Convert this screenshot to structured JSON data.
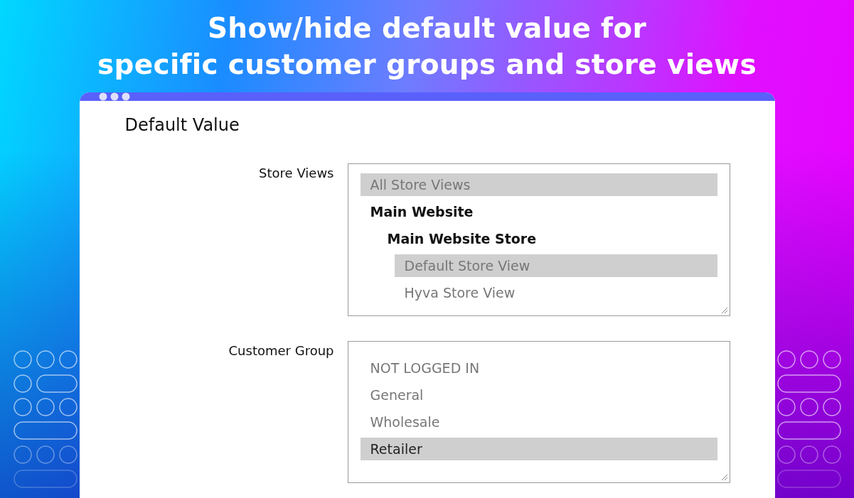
{
  "headline": [
    "Show/hide default value for",
    "specific customer groups and store views"
  ],
  "section_title": "Default Value",
  "fields": [
    {
      "label": "Store Views",
      "options": [
        {
          "text": "All Store Views",
          "kind": "option",
          "selected": true
        },
        {
          "text": "Main Website",
          "kind": "group",
          "children": [
            {
              "text": "Main Website Store",
              "kind": "group",
              "children": [
                {
                  "text": "Default Store View",
                  "kind": "option",
                  "selected": true
                },
                {
                  "text": "Hyva Store View",
                  "kind": "option",
                  "selected": false
                }
              ]
            }
          ]
        }
      ]
    },
    {
      "label": "Customer Group",
      "options": [
        {
          "text": "NOT LOGGED IN",
          "kind": "option",
          "selected": false
        },
        {
          "text": "General",
          "kind": "option",
          "selected": false
        },
        {
          "text": "Wholesale",
          "kind": "option",
          "selected": false
        },
        {
          "text": "Retailer",
          "kind": "option",
          "selected": true
        }
      ]
    }
  ]
}
